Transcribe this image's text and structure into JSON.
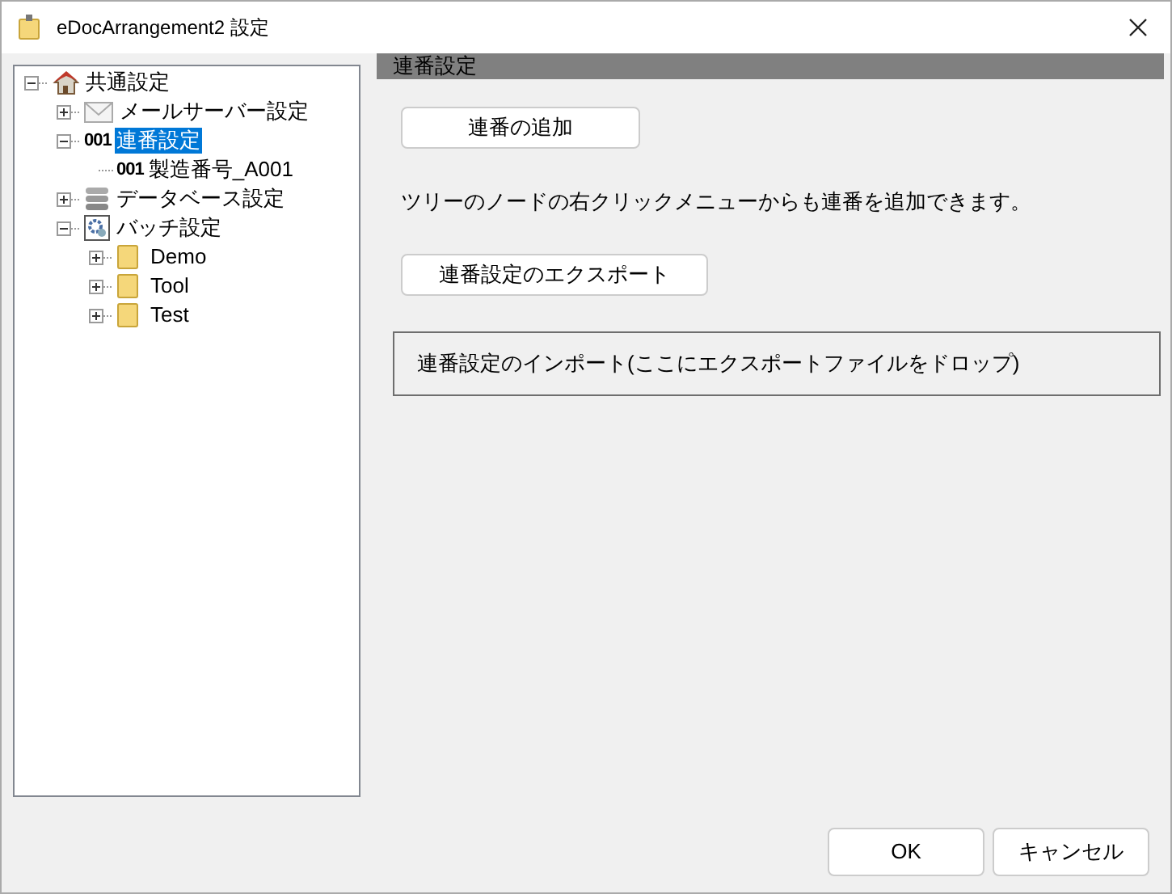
{
  "window": {
    "title": "eDocArrangement2 設定"
  },
  "tree": [
    {
      "label": "共通設定",
      "kind": "house",
      "expanded": true,
      "selected": false,
      "children": [
        {
          "label": "メールサーバー設定",
          "kind": "mail",
          "expanded": false,
          "selected": false
        },
        {
          "label": "連番設定",
          "kind": "counter",
          "prefix": "001",
          "expanded": true,
          "selected": true,
          "children": [
            {
              "label": "製造番号_A001",
              "kind": "counter",
              "prefix": "001",
              "selected": false
            }
          ]
        },
        {
          "label": "データベース設定",
          "kind": "database",
          "expanded": false,
          "selected": false
        },
        {
          "label": "バッチ設定",
          "kind": "batch",
          "expanded": true,
          "selected": false,
          "children": [
            {
              "label": "Demo",
              "kind": "folder",
              "expanded": false,
              "selected": false
            },
            {
              "label": "Tool",
              "kind": "folder",
              "expanded": false,
              "selected": false
            },
            {
              "label": "Test",
              "kind": "folder",
              "expanded": false,
              "selected": false
            }
          ]
        }
      ]
    }
  ],
  "panel": {
    "header": "連番設定",
    "add_button": "連番の追加",
    "hint": "ツリーのノードの右クリックメニューからも連番を追加できます。",
    "export_button": "連番設定のエクスポート",
    "import_drop": "連番設定のインポート(ここにエクスポートファイルをドロップ)"
  },
  "buttons": [
    "OK",
    "キャンセル"
  ]
}
